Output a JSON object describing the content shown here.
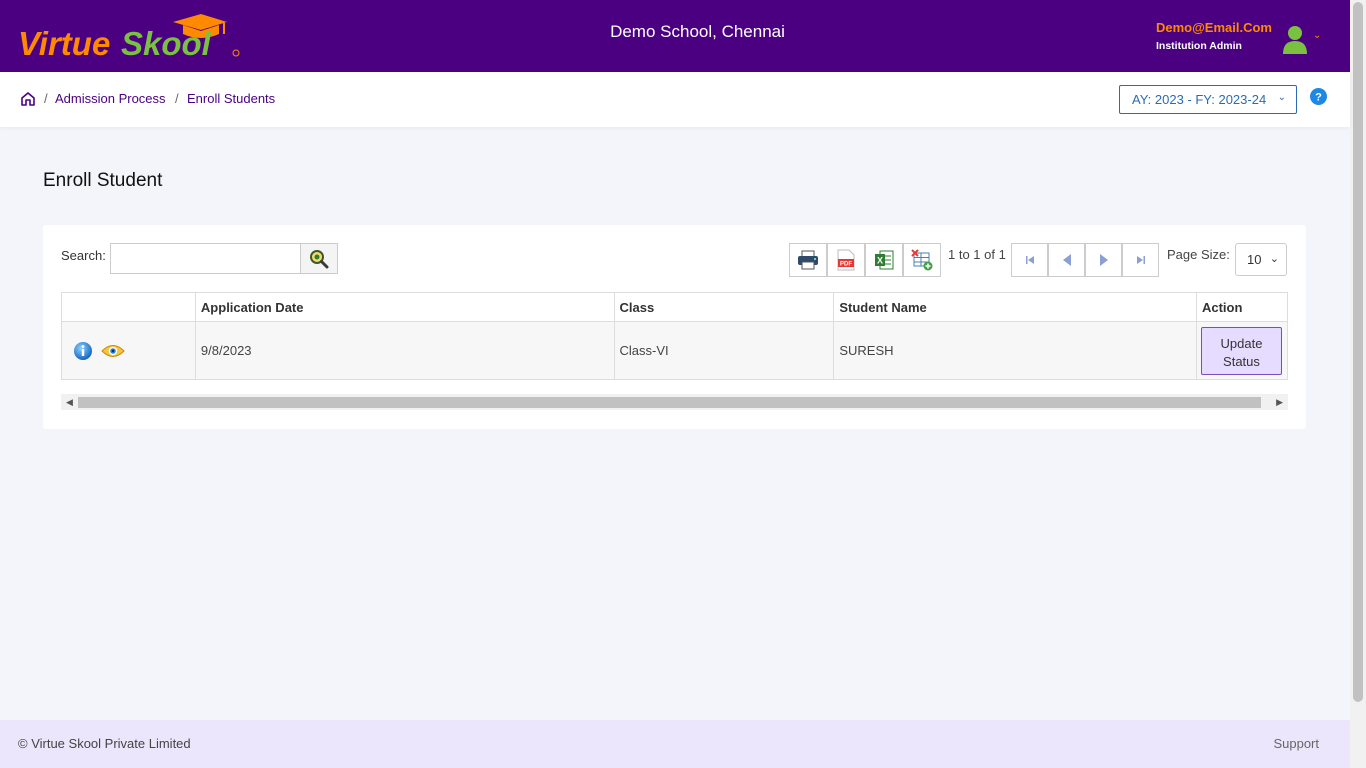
{
  "header": {
    "logo_text_virtue": "Virtue",
    "logo_text_skool": "Skool",
    "school_name": "Demo School, Chennai",
    "user_email": "Demo@Email.Com",
    "user_role": "Institution Admin"
  },
  "breadcrumb": {
    "items": [
      "Admission Process",
      "Enroll Students"
    ],
    "separator": "/"
  },
  "academic_year": "AY: 2023 - FY: 2023-24",
  "page_title": "Enroll Student",
  "toolbar": {
    "search_label": "Search:",
    "page_info": "1 to 1 of 1",
    "page_size_label": "Page Size:",
    "page_size_value": "10",
    "tools": [
      "print-icon",
      "pdf-icon",
      "excel-icon",
      "column-chooser-icon"
    ]
  },
  "table": {
    "columns": [
      "",
      "Application Date",
      "Class",
      "Student Name",
      "Action"
    ],
    "rows": [
      {
        "application_date": "9/8/2023",
        "class": "Class-VI",
        "student_name": "SURESH",
        "action_label": "Update Status"
      }
    ]
  },
  "footer": {
    "copyright": "© Virtue Skool Private Limited",
    "support": "Support"
  },
  "colors": {
    "header_bg": "#4b0082",
    "accent_orange": "#ff8a00",
    "logo_green": "#7ac142",
    "link_blue": "#2b6cb0",
    "footer_bg": "#ebe6fb"
  }
}
